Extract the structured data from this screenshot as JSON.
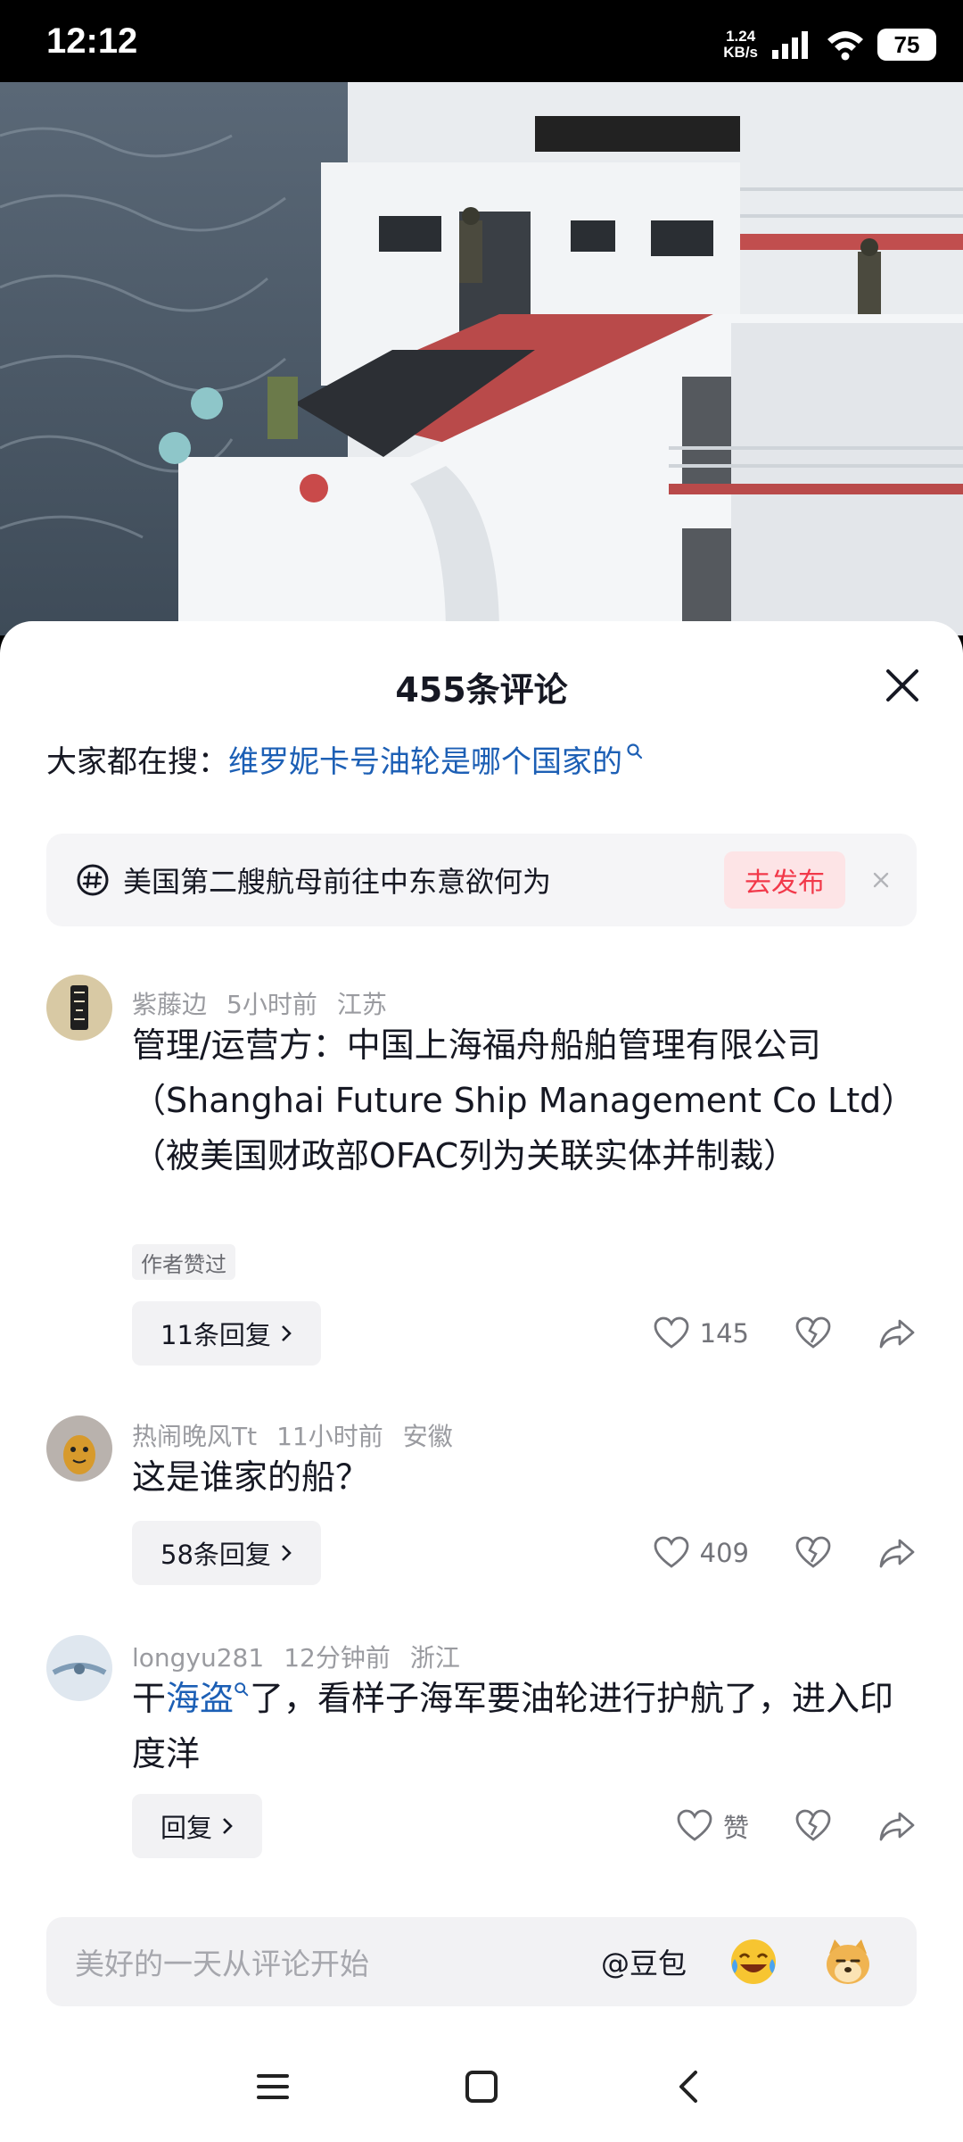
{
  "status_bar": {
    "time": "12:12",
    "net_speed_value": "1.24",
    "net_speed_unit": "KB/s",
    "battery": "75"
  },
  "comments_sheet": {
    "title": "455条评论",
    "search_hint_prefix": "大家都在搜：",
    "search_hint_query": "维罗妮卡号油轮是哪个国家的",
    "topic": {
      "text": "美国第二艘航母前往中东意欲何为",
      "button": "去发布"
    },
    "comments": [
      {
        "username": "紫藤边",
        "time": "5小时前",
        "location": "江苏",
        "text": "管理/运营方：中国上海福舟船舶管理有限公司（Shanghai Future Ship Management Co Ltd）（被美国财政部OFAC列为关联实体并制裁）",
        "author_tag": "作者赞过",
        "replies": "11条回复",
        "likes": "145"
      },
      {
        "username": "热闹晚风Tt",
        "time": "11小时前",
        "location": "安徽",
        "text": "这是谁家的船？",
        "replies": "58条回复",
        "likes": "409"
      },
      {
        "username": "longyu281",
        "time": "12分钟前",
        "location": "浙江",
        "text_prefix": "干",
        "text_link": "海盗",
        "text_suffix": "了，看样子海军要油轮进行护航了，进入印度洋",
        "replies": "回复",
        "likes": "赞"
      }
    ]
  },
  "input_bar": {
    "placeholder": "美好的一天从评论开始",
    "mention": "@豆包"
  },
  "icons": {
    "close": "close-icon",
    "search": "search-icon",
    "topic": "hashtag-icon",
    "like": "heart-icon",
    "dislike": "broken-heart-icon",
    "share": "share-icon",
    "emoji_laugh": "laugh-cry-emoji-icon",
    "emoji_doge": "doge-emoji-icon"
  },
  "colors": {
    "link": "#1c5fb5",
    "accent_red": "#f2394a",
    "muted": "#9a9ba0"
  }
}
